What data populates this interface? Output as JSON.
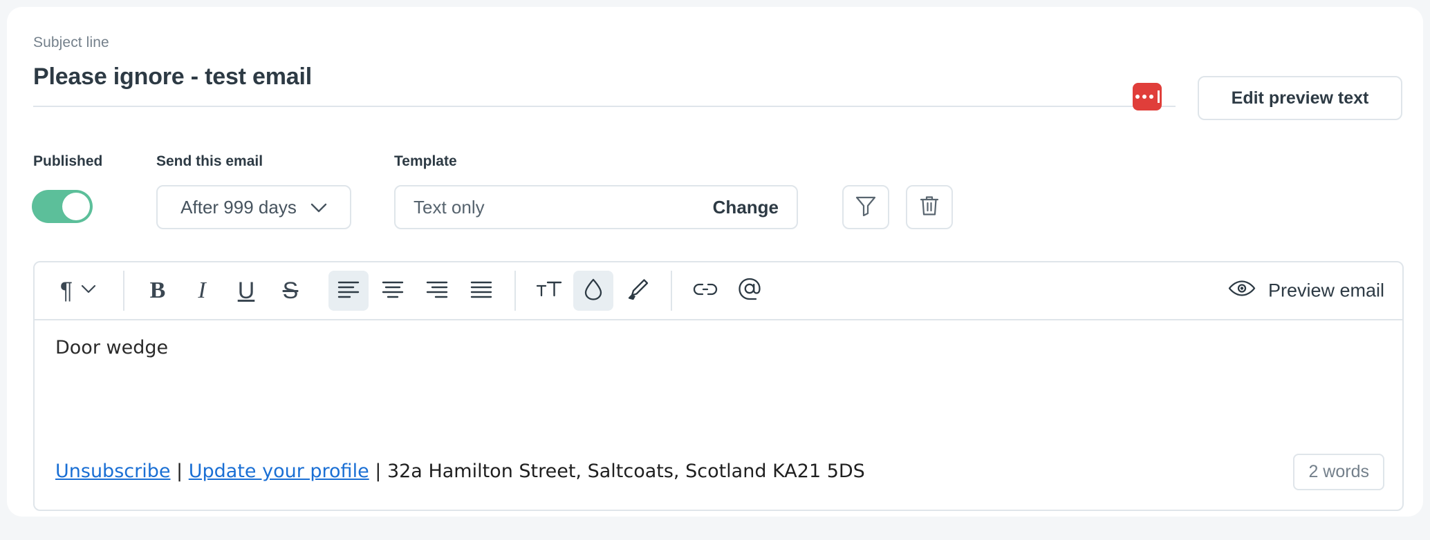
{
  "subject": {
    "label": "Subject line",
    "value": "Please ignore - test email",
    "preview_badge_icon": "preview-text-indicator-icon",
    "edit_preview_label": "Edit preview text",
    "badge_color": "#e03e3a"
  },
  "controls": {
    "published_label": "Published",
    "published_on": true,
    "toggle_color": "#5cbf9a",
    "send_label": "Send this email",
    "send_value": "After 999 days",
    "template_label": "Template",
    "template_value": "Text only",
    "change_label": "Change",
    "filter_icon": "filter-icon",
    "trash_icon": "trash-icon"
  },
  "toolbar": {
    "paragraph_icon": "pilcrow-icon",
    "paragraph_chevron": "chevron-down-icon",
    "bold": "B",
    "italic": "I",
    "underline": "U",
    "strikethrough": "S",
    "align_left_icon": "align-left-icon",
    "align_center_icon": "align-center-icon",
    "align_right_icon": "align-right-icon",
    "align_justify_icon": "align-justify-icon",
    "font_size_icon": "font-size-icon",
    "text_color_icon": "text-color-droplet-icon",
    "highlight_icon": "highlighter-icon",
    "link_icon": "link-icon",
    "mention_icon": "mention-at-icon",
    "active_items": [
      "align-left",
      "text-color"
    ],
    "preview_email_label": "Preview email",
    "preview_email_icon": "eye-icon"
  },
  "body": {
    "text": "Door wedge",
    "footer": {
      "unsubscribe": "Unsubscribe",
      "separator_1": " | ",
      "update_profile": "Update your profile",
      "separator_2": " | ",
      "address": "32a Hamilton Street, Saltcoats, Scotland KA21 5DS",
      "link_color": "#1a6fd4"
    },
    "word_count": "2 words"
  }
}
